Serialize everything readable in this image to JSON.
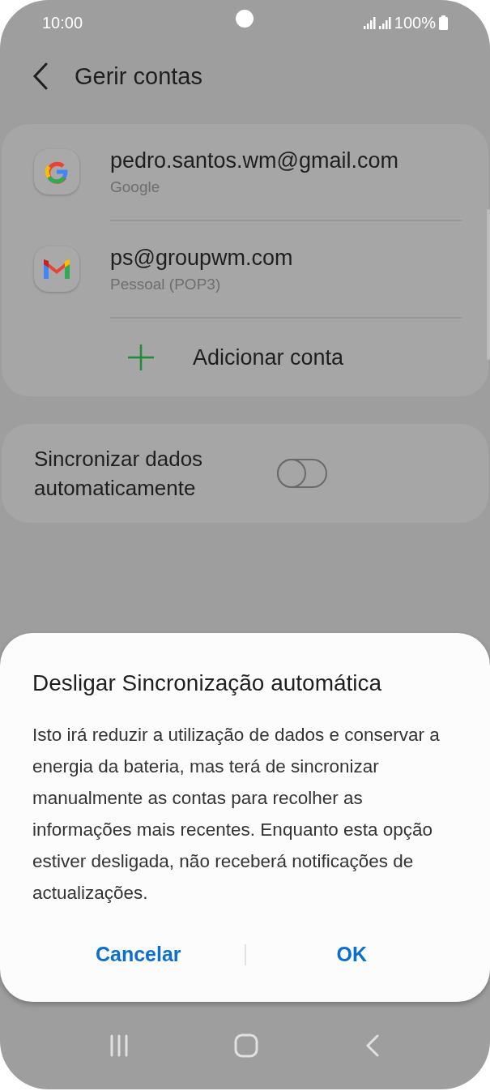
{
  "status_bar": {
    "time": "10:00",
    "battery": "100%"
  },
  "header": {
    "title": "Gerir contas"
  },
  "accounts": [
    {
      "kind": "google",
      "email": "pedro.santos.wm@gmail.com",
      "type": "Google"
    },
    {
      "kind": "gmail",
      "email": "ps@groupwm.com",
      "type": "Pessoal (POP3)"
    }
  ],
  "add_account": {
    "label": "Adicionar conta"
  },
  "auto_sync": {
    "label": "Sincronizar dados automaticamente",
    "on": false
  },
  "dialog": {
    "title": "Desligar Sincronização automática",
    "message": "Isto irá reduzir a utilização de dados e conservar a energia da bateria, mas terá de sincronizar manualmente as contas para recolher as informações mais recentes. Enquanto esta opção estiver desligada, não receberá notificações de actualizações.",
    "buttons": [
      "Cancelar",
      "OK"
    ]
  }
}
